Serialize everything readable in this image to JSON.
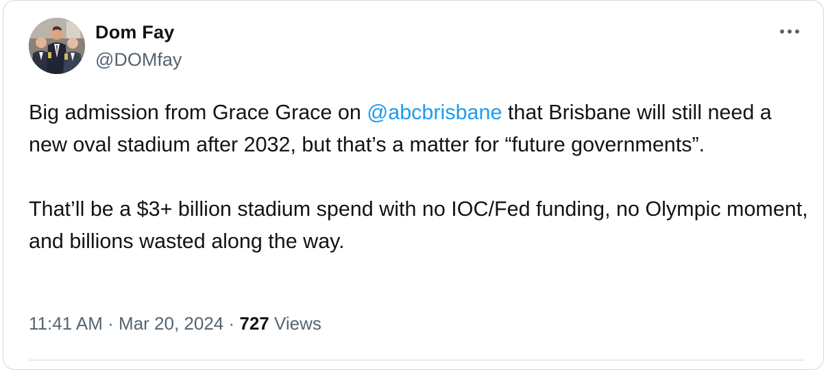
{
  "author": {
    "display_name": "Dom Fay",
    "handle": "@DOMfay",
    "avatar_icon": "profile-photo"
  },
  "tweet": {
    "paragraph1": {
      "before_mention": "Big admission from Grace Grace on ",
      "mention": "@abcbrisbane",
      "after_mention": " that Brisbane will still need a new oval stadium after 2032, but that’s a matter for “future governments”."
    },
    "paragraph2": "That’ll be a $3+ billion stadium spend with no IOC/Fed funding, no Olympic moment, and billions wasted along the way."
  },
  "meta": {
    "time": "11:41 AM",
    "separator": " · ",
    "date": "Mar 20, 2024",
    "views_count": "727",
    "views_label": " Views"
  },
  "colors": {
    "link": "#1d9bf0",
    "text_primary": "#0f1419",
    "text_secondary": "#536471",
    "border": "#cfd9de"
  },
  "icons": {
    "more": "more-horizontal-icon"
  }
}
